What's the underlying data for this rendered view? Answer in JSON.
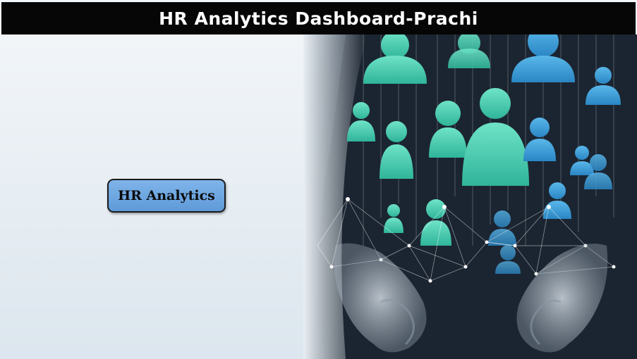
{
  "header": {
    "title": "HR Analytics Dashboard-Prachi"
  },
  "main": {
    "hr_button_label": "HR Analytics"
  },
  "colors": {
    "title_bar": "#060606",
    "button_fill": "#6fa7e0",
    "people_teal": "#4fd1b5",
    "people_blue": "#2f9ad6"
  },
  "hero": {
    "image_name": "hr-people-network-illustration"
  }
}
